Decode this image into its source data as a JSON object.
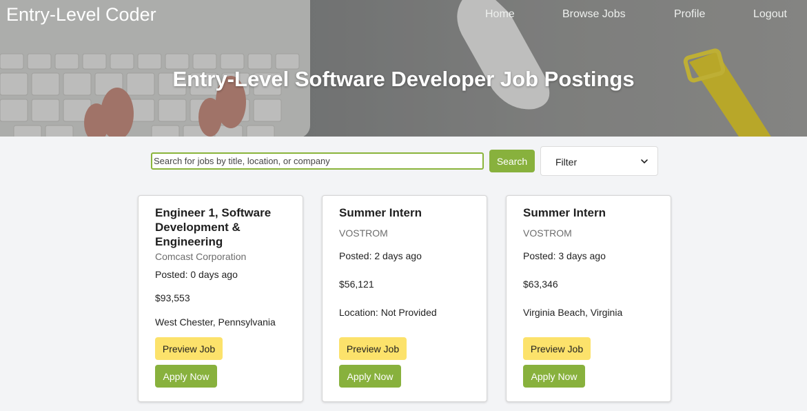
{
  "header": {
    "brand": "Entry-Level Coder",
    "nav": [
      {
        "label": "Home"
      },
      {
        "label": "Browse Jobs"
      },
      {
        "label": "Profile"
      },
      {
        "label": "Logout"
      }
    ],
    "hero_title": "Entry-Level Software Developer Job Postings"
  },
  "search": {
    "placeholder": "Search for jobs by title, location, or company",
    "value": "",
    "button_label": "Search",
    "filter_selected": "Filter"
  },
  "jobs": [
    {
      "title": "Engineer 1, Software Development & Engineering",
      "company": "Comcast Corporation",
      "posted": "Posted: 0 days ago",
      "salary": "$93,553",
      "location": "West Chester, Pennsylvania",
      "preview_label": "Preview Job",
      "apply_label": "Apply Now"
    },
    {
      "title": "Summer Intern",
      "company": "VOSTROM",
      "posted": "Posted: 2 days ago",
      "salary": "$56,121",
      "location": "Location: Not Provided",
      "preview_label": "Preview Job",
      "apply_label": "Apply Now"
    },
    {
      "title": "Summer Intern",
      "company": "VOSTROM",
      "posted": "Posted: 3 days ago",
      "salary": "$63,346",
      "location": "Virginia Beach, Virginia",
      "preview_label": "Preview Job",
      "apply_label": "Apply Now"
    }
  ],
  "colors": {
    "accent_green": "#88b13d",
    "preview_yellow": "#fce26b",
    "page_background": "#f3f4f6"
  }
}
